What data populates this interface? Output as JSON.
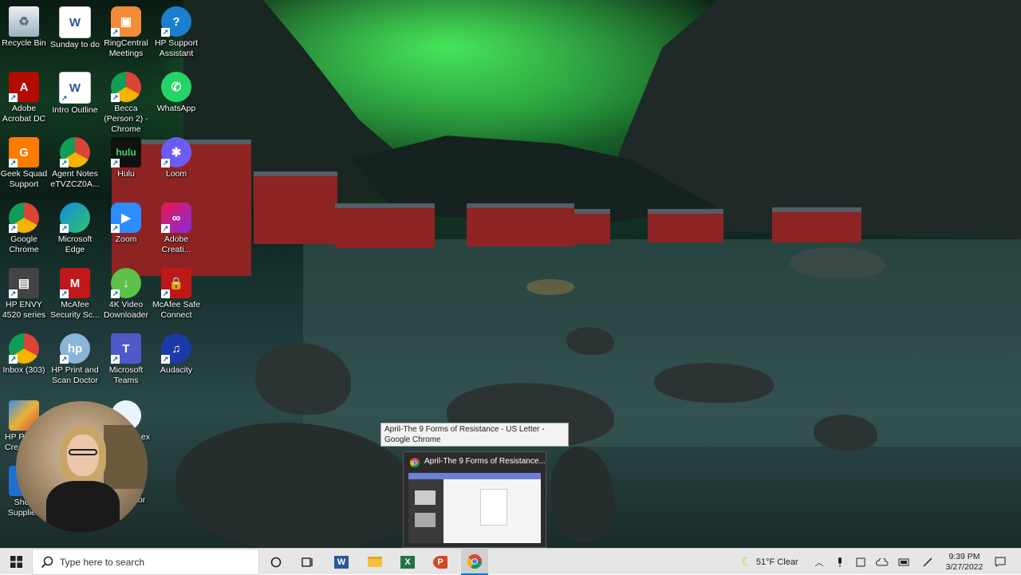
{
  "desktop_icons": [
    {
      "label": "Recycle Bin",
      "icon": "recycle-bin-icon"
    },
    {
      "label": "Sunday to do",
      "icon": "word-document-icon"
    },
    {
      "label": "RingCentral Meetings",
      "icon": "ringcentral-icon"
    },
    {
      "label": "HP Support Assistant",
      "icon": "hp-support-icon"
    },
    {
      "label": "Adobe Acrobat DC",
      "icon": "acrobat-icon"
    },
    {
      "label": "Intro Outline",
      "icon": "word-document-icon"
    },
    {
      "label": "Becca (Person 2) - Chrome",
      "icon": "chrome-profile-icon"
    },
    {
      "label": "WhatsApp",
      "icon": "whatsapp-icon"
    },
    {
      "label": "Geek Squad Support",
      "icon": "geek-squad-icon"
    },
    {
      "label": "Agent Notes eTVZCZ0A...",
      "icon": "chrome-icon"
    },
    {
      "label": "Hulu",
      "icon": "hulu-icon"
    },
    {
      "label": "Loom",
      "icon": "loom-icon"
    },
    {
      "label": "Google Chrome",
      "icon": "chrome-icon"
    },
    {
      "label": "Microsoft Edge",
      "icon": "edge-icon"
    },
    {
      "label": "Zoom",
      "icon": "zoom-icon"
    },
    {
      "label": "Adobe Creati...",
      "icon": "creative-cloud-icon"
    },
    {
      "label": "HP ENVY 4520 series",
      "icon": "printer-icon"
    },
    {
      "label": "McAfee Security Sc...",
      "icon": "mcafee-icon"
    },
    {
      "label": "4K Video Downloader",
      "icon": "video-downloader-icon"
    },
    {
      "label": "McAfee Safe Connect",
      "icon": "mcafee-safe-connect-icon"
    },
    {
      "label": "Inbox (303)",
      "icon": "chrome-icon"
    },
    {
      "label": "HP Print and Scan Doctor",
      "icon": "hp-print-scan-icon"
    },
    {
      "label": "Microsoft Teams",
      "icon": "teams-icon"
    },
    {
      "label": "Audacity",
      "icon": "audacity-icon"
    }
  ],
  "partial_icons": {
    "left_a": "HP P",
    "left_a2": "Cre",
    "left_b": "Shop",
    "left_b2": "Supplies",
    "right_a": "ex",
    "right_b": "tor"
  },
  "tooltip": {
    "text": "April-The 9 Forms of Resistance - US Letter - Google Chrome"
  },
  "thumbnail": {
    "title": "April-The 9 Forms of Resistance..."
  },
  "taskbar": {
    "search_placeholder": "Type here to search",
    "weather": "51°F  Clear",
    "time": "9:39 PM",
    "date": "3/27/2022"
  },
  "colors": {
    "word": "#2b579a",
    "excel": "#217346",
    "powerpoint": "#d24726",
    "chrome_red": "#db4437",
    "chrome_yellow": "#f4b400",
    "chrome_green": "#0f9d58",
    "chrome_blue": "#4285f4"
  }
}
